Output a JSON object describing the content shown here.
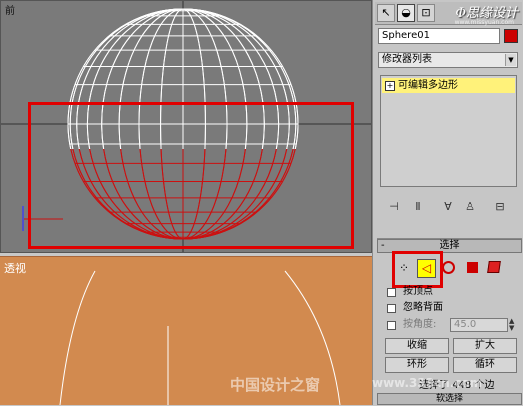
{
  "viewports": {
    "front": {
      "label": "前"
    },
    "perspective": {
      "label": "透视"
    }
  },
  "panel": {
    "logo": "Φ思缘设计",
    "logo_sub": "www.missyuan.com",
    "object_name": "Sphere01",
    "object_color": "#cc0000",
    "modifier_list": "修改器列表",
    "stack_item": "可编辑多边形",
    "stack_item_plus": "+"
  },
  "selection": {
    "title": "选择",
    "by_vertex": "按顶点",
    "ignore_backfacing": "忽略背面",
    "by_angle": "按角度:",
    "angle_value": "45.0",
    "shrink": "收缩",
    "grow": "扩大",
    "ring": "环形",
    "loop": "循环",
    "status": "选择了 448 个边",
    "next_rollout": "软选择"
  },
  "watermark": {
    "cn": "中国设计之窗",
    "url": "www.333cn.com"
  },
  "colors": {
    "highlight": "#e00000",
    "active_subobj": "#ffff00",
    "sphere_top": "#ffffff",
    "sphere_bottom": "#cc1010"
  }
}
